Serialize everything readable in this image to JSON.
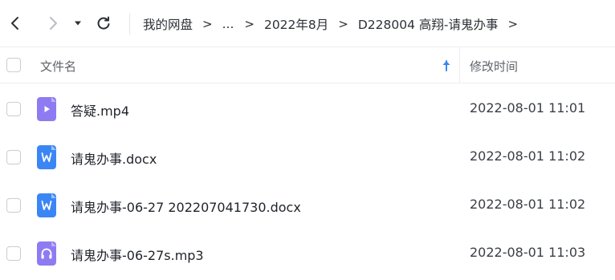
{
  "breadcrumb": {
    "items": [
      "我的网盘",
      "...",
      "2022年8月",
      "D228004 高翔-请鬼办事"
    ],
    "separator": ">"
  },
  "table": {
    "header": {
      "name_label": "文件名",
      "time_label": "修改时间",
      "sort_direction": "ascending"
    },
    "rows": [
      {
        "name": "答疑.mp4",
        "modified": "2022-08-01 11:01",
        "icon": "video-file-icon",
        "color": "#8f7bf1"
      },
      {
        "name": "请鬼办事.docx",
        "modified": "2022-08-01 11:02",
        "icon": "word-file-icon",
        "color": "#3b86f5"
      },
      {
        "name": "请鬼办事-06-27 202207041730.docx",
        "modified": "2022-08-01 11:02",
        "icon": "word-file-icon",
        "color": "#3b86f5"
      },
      {
        "name": "请鬼办事-06-27s.mp3",
        "modified": "2022-08-01 11:03",
        "icon": "audio-file-icon",
        "color": "#8f7bf1"
      }
    ]
  },
  "colors": {
    "accent": "#3b86f5",
    "media": "#8f7bf1"
  }
}
